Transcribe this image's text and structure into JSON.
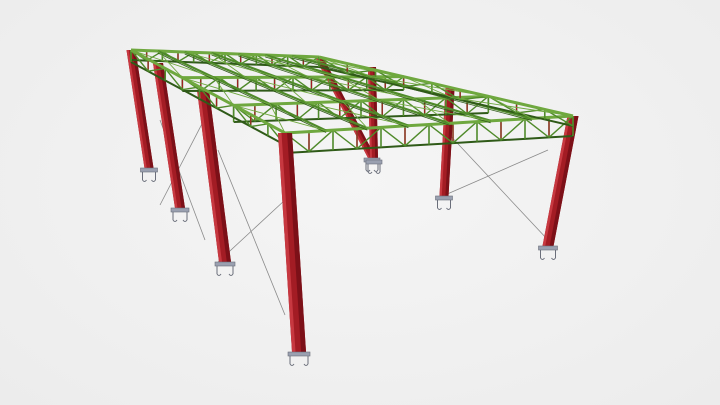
{
  "scene": {
    "subject": "steel-frame-structure",
    "colors": {
      "background": "#eeeeee",
      "column": "#a31c24",
      "column_shade": "#7c1018",
      "column_light": "#c73840",
      "truss": "#4f8a2a",
      "truss_dark": "#2f5a18",
      "truss_light": "#6fa83f",
      "bracing": "#8a8a8a",
      "base_plate": "#9aa0b0",
      "anchor": "#6a6e7a"
    },
    "frames": 4,
    "bays": 3,
    "purlin_rows": 7
  }
}
